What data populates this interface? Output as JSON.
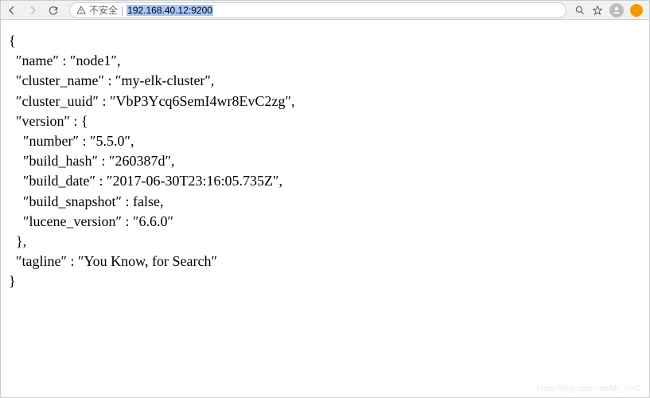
{
  "toolbar": {
    "insecure_label": "不安全",
    "url": "192.168.40.12:9200"
  },
  "response": {
    "name": "node1",
    "cluster_name": "my-elk-cluster",
    "cluster_uuid": "VbP3Ycq6SemI4wr8EvC2zg",
    "version": {
      "number": "5.5.0",
      "build_hash": "260387d",
      "build_date": "2017-06-30T23:16:05.735Z",
      "build_snapshot": "false",
      "lucene_version": "6.6.0"
    },
    "tagline": "You Know, for Search"
  },
  "labels": {
    "name": "name",
    "cluster_name": "cluster_name",
    "cluster_uuid": "cluster_uuid",
    "version": "version",
    "number": "number",
    "build_hash": "build_hash",
    "build_date": "build_date",
    "build_snapshot": "build_snapshot",
    "lucene_version": "lucene_version",
    "tagline": "tagline"
  },
  "watermark": "https://blog.csdn.net/Mr_XHC"
}
